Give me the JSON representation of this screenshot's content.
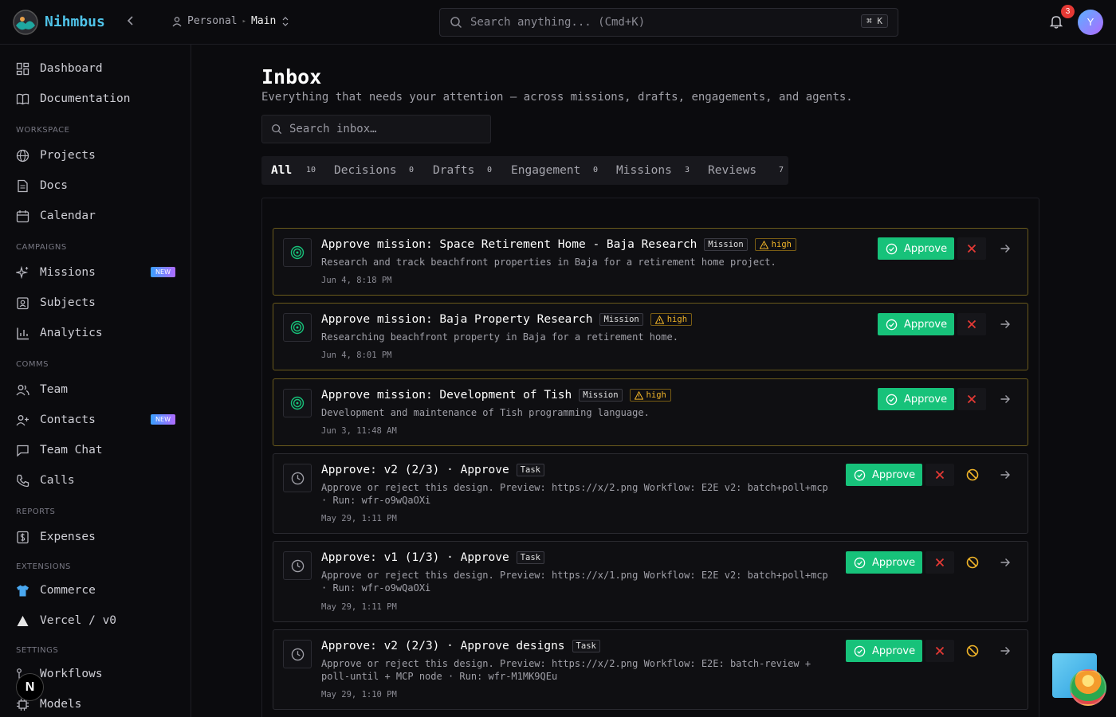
{
  "app": {
    "brand": "Nihmbus"
  },
  "topbar": {
    "workspace_scope": "Personal",
    "workspace_name": "Main",
    "search_placeholder": "Search anything... (Cmd+K)",
    "search_shortcut": "⌘ K",
    "notifications_count": "3",
    "avatar_initial": "Y"
  },
  "sidebar": {
    "top_items": [
      {
        "label": "Dashboard",
        "icon": "dashboard-icon"
      },
      {
        "label": "Documentation",
        "icon": "book-icon"
      }
    ],
    "sections": [
      {
        "title": "WORKSPACE",
        "items": [
          {
            "label": "Projects",
            "icon": "globe-icon"
          },
          {
            "label": "Docs",
            "icon": "doc-icon"
          },
          {
            "label": "Calendar",
            "icon": "calendar-icon"
          }
        ]
      },
      {
        "title": "CAMPAIGNS",
        "items": [
          {
            "label": "Missions",
            "icon": "sparkle-icon",
            "badge": "NEW"
          },
          {
            "label": "Subjects",
            "icon": "contact-card-icon"
          },
          {
            "label": "Analytics",
            "icon": "bar-chart-icon"
          }
        ]
      },
      {
        "title": "COMMS",
        "items": [
          {
            "label": "Team",
            "icon": "users-icon"
          },
          {
            "label": "Contacts",
            "icon": "user-plus-icon",
            "badge": "NEW"
          },
          {
            "label": "Team Chat",
            "icon": "chat-icon"
          },
          {
            "label": "Calls",
            "icon": "phone-icon"
          }
        ]
      },
      {
        "title": "REPORTS",
        "items": [
          {
            "label": "Expenses",
            "icon": "dollar-icon"
          }
        ]
      },
      {
        "title": "EXTENSIONS",
        "items": [
          {
            "label": "Commerce",
            "icon": "shirt-icon"
          },
          {
            "label": "Vercel / v0",
            "icon": "triangle-icon"
          }
        ]
      },
      {
        "title": "SETTINGS",
        "items": [
          {
            "label": "Workflows",
            "icon": "workflow-icon"
          },
          {
            "label": "Models",
            "icon": "chip-icon"
          }
        ]
      }
    ]
  },
  "inbox": {
    "title": "Inbox",
    "subtitle": "Everything that needs your attention — across missions, drafts, engagements, and agents.",
    "search_placeholder": "Search inbox…",
    "tabs": [
      {
        "label": "All",
        "count": "10",
        "active": true
      },
      {
        "label": "Decisions",
        "count": "0"
      },
      {
        "label": "Drafts",
        "count": "0"
      },
      {
        "label": "Engagement",
        "count": "0"
      },
      {
        "label": "Missions",
        "count": "3"
      },
      {
        "label": "Reviews",
        "count": "7"
      }
    ],
    "approve_label": "Approve",
    "items": [
      {
        "title": "Approve mission: Space Retirement Home - Baja Research",
        "type": "Mission",
        "priority": "high",
        "desc": "Research and track beachfront properties in Baja for a retirement home project.",
        "date": "Jun 4, 8:18 PM"
      },
      {
        "title": "Approve mission: Baja Property Research",
        "type": "Mission",
        "priority": "high",
        "desc": "Researching beachfront property in Baja for a retirement home.",
        "date": "Jun 4, 8:01 PM"
      },
      {
        "title": "Approve mission: Development of Tish",
        "type": "Mission",
        "priority": "high",
        "desc": "Development and maintenance of Tish programming language.",
        "date": "Jun 3, 11:48 AM"
      },
      {
        "title": "Approve: v2 (2/3) · Approve",
        "type": "Task",
        "desc": "Approve or reject this design. Preview: https://x/2.png Workflow: E2E v2: batch+poll+mcp · Run: wfr-o9wQaOXi",
        "date": "May 29, 1:11 PM"
      },
      {
        "title": "Approve: v1 (1/3) · Approve",
        "type": "Task",
        "desc": "Approve or reject this design. Preview: https://x/1.png Workflow: E2E v2: batch+poll+mcp · Run: wfr-o9wQaOXi",
        "date": "May 29, 1:11 PM"
      },
      {
        "title": "Approve: v2 (2/3) · Approve designs",
        "type": "Task",
        "desc": "Approve or reject this design. Preview: https://x/2.png Workflow: E2E: batch-review + poll-until + MCP node · Run: wfr-M1MK9QEu",
        "date": "May 29, 1:10 PM"
      }
    ]
  },
  "floating": {
    "n_button": "N"
  },
  "colors": {
    "accent": "#4fc3e8",
    "approve": "#17c27a",
    "reject": "#e53935",
    "warning": "#f0b429",
    "mission_border": "#6a5a1c"
  }
}
